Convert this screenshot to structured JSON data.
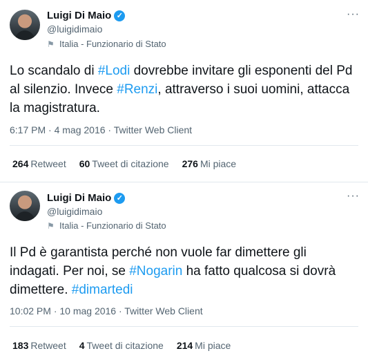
{
  "tweets": [
    {
      "name": "Luigi Di Maio",
      "handle": "@luigidimaio",
      "location": "Italia - Funzionario di Stato",
      "more": "···",
      "text": {
        "p1": "Lo scandalo di ",
        "h1": "#Lodi",
        "p2": " dovrebbe invitare gli esponenti del Pd al silenzio. Invece ",
        "h2": "#Renzi",
        "p3": ", attraverso i suoi uomini, attacca la magistratura."
      },
      "timestamp": "6:17 PM · 4 mag 2016 · Twitter Web Client",
      "stats": {
        "retweets": "264",
        "retweets_label": "Retweet",
        "quotes": "60",
        "quotes_label": "Tweet di citazione",
        "likes": "276",
        "likes_label": "Mi piace"
      }
    },
    {
      "name": "Luigi Di Maio",
      "handle": "@luigidimaio",
      "location": "Italia - Funzionario di Stato",
      "more": "···",
      "text": {
        "p1": "Il Pd è garantista perché non vuole far dimettere gli indagati. Per noi, se ",
        "h1": "#Nogarin",
        "p2": " ha fatto qualcosa si dovrà dimettere. ",
        "h2": "#dimartedi"
      },
      "timestamp": "10:02 PM · 10 mag 2016 · Twitter Web Client",
      "stats": {
        "retweets": "183",
        "retweets_label": "Retweet",
        "quotes": "4",
        "quotes_label": "Tweet di citazione",
        "likes": "214",
        "likes_label": "Mi piace"
      }
    }
  ]
}
